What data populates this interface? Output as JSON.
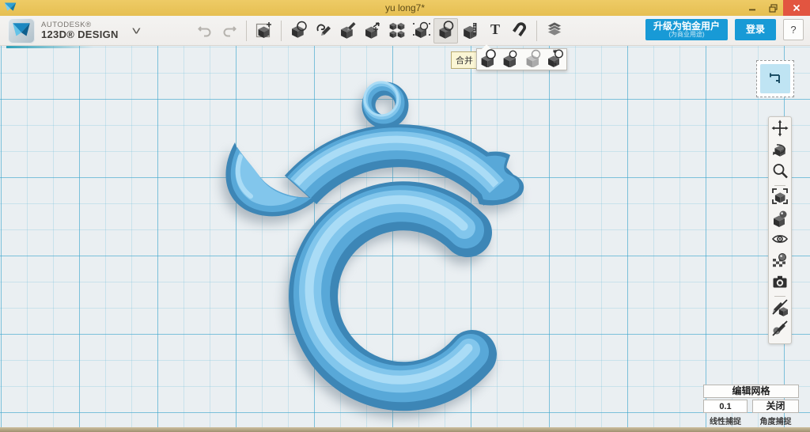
{
  "window": {
    "title": "yu long7*",
    "controls": [
      {
        "name": "minimize",
        "icon": "minimize-icon"
      },
      {
        "name": "restore",
        "icon": "restore-icon"
      },
      {
        "name": "close",
        "icon": "close-icon"
      }
    ]
  },
  "brand": {
    "line1": "AUTODESK®",
    "line2": "123D® DESIGN",
    "logo_icon": "123d-logo-icon",
    "menu_chevron": "˅"
  },
  "toolbar": {
    "items": [
      {
        "name": "undo",
        "icon": "undo-icon",
        "disabled": true
      },
      {
        "name": "redo",
        "icon": "redo-icon",
        "disabled": true
      },
      {
        "divider": true
      },
      {
        "name": "primitives",
        "icon": "primitives-icon"
      },
      {
        "divider": true
      },
      {
        "name": "sketch",
        "icon": "sketch-icon"
      },
      {
        "name": "draw",
        "icon": "draw-icon"
      },
      {
        "name": "modify",
        "icon": "modify-icon"
      },
      {
        "name": "transform",
        "icon": "transform-icon"
      },
      {
        "name": "pattern",
        "icon": "pattern-icon"
      },
      {
        "name": "grouping",
        "icon": "grouping-icon"
      },
      {
        "name": "combine",
        "icon": "combine-icon",
        "active": true
      },
      {
        "name": "measure",
        "icon": "measure-icon"
      },
      {
        "name": "text",
        "icon": "text-icon"
      },
      {
        "name": "snap",
        "icon": "snap-icon"
      },
      {
        "divider": true
      },
      {
        "name": "3d-print",
        "icon": "print-icon"
      }
    ],
    "upgrade_button": {
      "label": "升级为铂金用户",
      "sublabel": "(为商业用途)"
    },
    "login_button": {
      "label": "登录"
    },
    "help_button": {
      "label": "?"
    }
  },
  "combine_menu": {
    "tooltip": "合并",
    "items": [
      {
        "name": "merge",
        "icon": "merge-icon"
      },
      {
        "name": "subtract",
        "icon": "subtract-icon"
      },
      {
        "name": "intersect",
        "icon": "intersect-icon"
      },
      {
        "name": "separate",
        "icon": "separate-icon"
      }
    ]
  },
  "nav_toolbar": {
    "items": [
      {
        "name": "pan",
        "icon": "pan-icon"
      },
      {
        "name": "orbit",
        "icon": "orbit-icon"
      },
      {
        "name": "zoom",
        "icon": "zoom-icon"
      },
      {
        "divider": true
      },
      {
        "name": "fit-view",
        "icon": "fit-icon"
      },
      {
        "name": "look-at",
        "icon": "lookat-icon"
      },
      {
        "name": "visibility",
        "icon": "visibility-icon"
      },
      {
        "name": "material",
        "icon": "material-icon"
      },
      {
        "name": "snapshot",
        "icon": "camera-icon"
      },
      {
        "divider": true
      },
      {
        "name": "hide-sketches",
        "icon": "hide-sketch-icon"
      },
      {
        "name": "hide-construction",
        "icon": "hide-construction-icon"
      }
    ]
  },
  "viewcube": {
    "icon": "viewcube-glyph"
  },
  "snap_panel": {
    "edit_grid_label": "编辑网格",
    "linear_snap_value": "0.1",
    "angle_snap_value": "关闭",
    "linear_snap_label": "线性捕捉",
    "angle_snap_label": "角度捕捉"
  },
  "model": {
    "description": "blue C-shaped pendant with hanging loop and horn",
    "base_color": "#3d86b6",
    "mid_color": "#58a8d8",
    "light_color": "#82c6ec",
    "highlight_color": "#aadcf6"
  },
  "colors": {
    "titlebar": "#e8c45c",
    "accent_blue": "#189ad6",
    "canvas_bg": "#eaeff2",
    "grid_major": "#3ca5cd",
    "grid_minor": "#7dc3dc",
    "close_red": "#e25540"
  }
}
